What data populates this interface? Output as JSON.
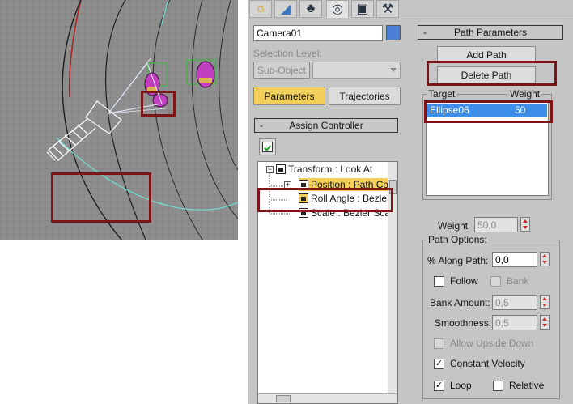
{
  "command_panel": {
    "tabs": [
      {
        "name": "create",
        "icon": "sun-icon",
        "glyph": "☼"
      },
      {
        "name": "modify",
        "icon": "modify-icon",
        "glyph": "◢"
      },
      {
        "name": "hierarchy",
        "icon": "hierarchy-icon",
        "glyph": "♣"
      },
      {
        "name": "motion",
        "icon": "motion-icon",
        "glyph": "◎"
      },
      {
        "name": "display",
        "icon": "display-icon",
        "glyph": "▣"
      },
      {
        "name": "utilities",
        "icon": "hammer-icon",
        "glyph": "⚒"
      }
    ],
    "object_name": "Camera01",
    "object_color": "#4a7fd4"
  },
  "selection_level": {
    "label": "Selection Level:",
    "sub_object_button": "Sub-Object",
    "dropdown_value": ""
  },
  "motion_tabs": {
    "parameters": "Parameters",
    "trajectories": "Trajectories"
  },
  "assign_controller": {
    "title": "Assign Controller",
    "minus": "-",
    "tree": [
      {
        "label": "Transform : Look At"
      },
      {
        "label": "Position : Path Co"
      },
      {
        "label": "Roll Angle : Bezie"
      },
      {
        "label": "Scale : Bezier Sca"
      }
    ]
  },
  "path_parameters": {
    "title": "Path Parameters",
    "minus": "-",
    "add_path": "Add Path",
    "delete_path": "Delete Path",
    "columns": {
      "target": "Target",
      "weight": "Weight"
    },
    "rows": [
      {
        "target": "Ellipse06",
        "weight": "50"
      }
    ],
    "weight_label": "Weight",
    "weight_value": "50,0"
  },
  "path_options": {
    "title": "Path Options:",
    "along_path_label": "% Along Path:",
    "along_path_value": "0,0",
    "follow": {
      "label": "Follow",
      "checked": false
    },
    "bank": {
      "label": "Bank",
      "checked": false
    },
    "bank_amount_label": "Bank Amount:",
    "bank_amount_value": "0,5",
    "smoothness_label": "Smoothness:",
    "smoothness_value": "0,5",
    "allow_upside_down": {
      "label": "Allow Upside Down",
      "checked": false
    },
    "constant_velocity": {
      "label": "Constant Velocity",
      "checked": true
    },
    "loop": {
      "label": "Loop",
      "checked": true
    },
    "relative": {
      "label": "Relative",
      "checked": false
    },
    "check_glyph": "✓"
  },
  "colors": {
    "highlight_red": "#7e1416",
    "selection_blue": "#3d8ee8",
    "yellow_highlight": "#f2cf5a",
    "viewport_gray": "#8e8e8e"
  }
}
